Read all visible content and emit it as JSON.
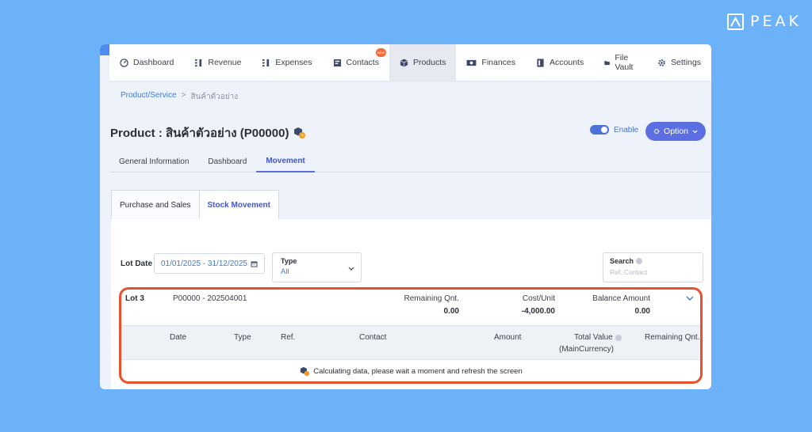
{
  "brand": {
    "name": "PEAK"
  },
  "nav": [
    {
      "label": "Dashboard",
      "icon": "dashboard-icon"
    },
    {
      "label": "Revenue",
      "icon": "revenue-icon"
    },
    {
      "label": "Expenses",
      "icon": "expenses-icon"
    },
    {
      "label": "Contacts",
      "icon": "contacts-icon",
      "badge": "NEW"
    },
    {
      "label": "Products",
      "icon": "products-icon",
      "active": true
    },
    {
      "label": "Finances",
      "icon": "finances-icon"
    },
    {
      "label": "Accounts",
      "icon": "accounts-icon"
    },
    {
      "label": "File Vault",
      "icon": "file-vault-icon"
    },
    {
      "label": "Settings",
      "icon": "gear-icon"
    }
  ],
  "breadcrumb": {
    "link": "Product/Service",
    "separator": ">",
    "current": "สินค้าตัวอย่าง"
  },
  "page": {
    "title": "Product : สินค้าตัวอย่าง (P00000)"
  },
  "enable": {
    "label": "Enable",
    "on": true
  },
  "option_button": {
    "label": "Option"
  },
  "sub_tabs": [
    "General Information",
    "Dashboard",
    "Movement"
  ],
  "inner_tabs": [
    "Purchase and Sales",
    "Stock Movement"
  ],
  "filters": {
    "lot_date_label": "Lot Date",
    "lot_date_value": "01/01/2025 - 31/12/2025",
    "type_label": "Type",
    "type_value": "All",
    "search_label": "Search",
    "search_placeholder": "Ref.,Contact"
  },
  "lot": {
    "title": "Lot 3",
    "code": "P00000 - 202504001",
    "remaining_label": "Remaining Qnt.",
    "remaining_value": "0.00",
    "cost_label": "Cost/Unit",
    "cost_value": "-4,000.00",
    "balance_label": "Balance Amount",
    "balance_value": "0.00"
  },
  "table": {
    "headers": {
      "date": "Date",
      "type": "Type",
      "ref": "Ref.",
      "contact": "Contact",
      "amount": "Amount",
      "total_value": "Total Value",
      "total_value_sub": "(MainCurrency)",
      "remaining": "Remaining Qnt."
    },
    "message": "Calculating data, please wait a moment and refresh the screen"
  },
  "colors": {
    "background": "#6cb2f8",
    "accent": "#5b6fe3",
    "highlight": "#e9502b",
    "link": "#3d7cd9"
  }
}
